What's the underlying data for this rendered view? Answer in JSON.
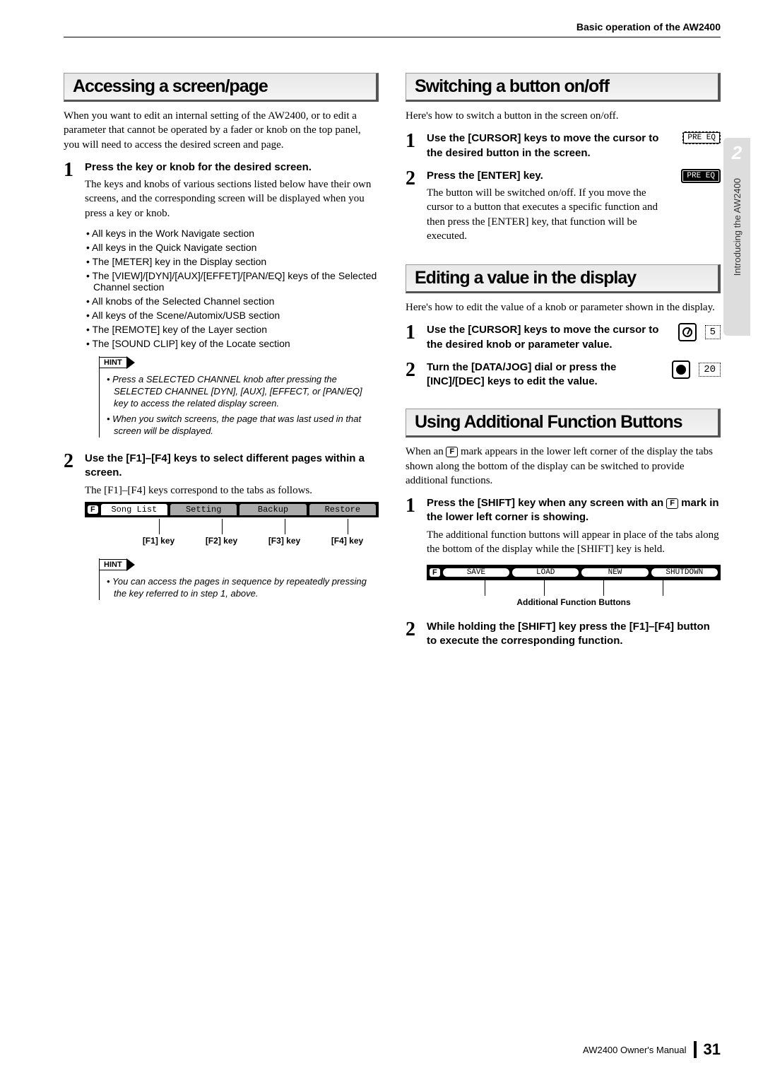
{
  "header": {
    "title": "Basic operation of the AW2400"
  },
  "sidetab": {
    "chapter": "2",
    "label": "Introducing the AW2400"
  },
  "left": {
    "h1": "Accessing a screen/page",
    "intro": "When you want to edit an internal setting of the AW2400, or to edit a parameter that cannot be operated by a fader or knob on the top panel, you will need to access the desired screen and page.",
    "s1": {
      "title": "Press the key or knob for the desired screen.",
      "para": "The keys and knobs of various sections listed below have their own screens, and the corresponding screen will be displayed when you press a key or knob.",
      "bullets": [
        "All keys in the Work Navigate section",
        "All keys in the Quick Navigate section",
        "The [METER] key in the Display section",
        "The [VIEW]/[DYN]/[AUX]/[EFFET]/[PAN/EQ] keys of the Selected Channel section",
        "All knobs of the Selected Channel section",
        "All keys of the Scene/Automix/USB section",
        "The [REMOTE] key of the Layer section",
        "The [SOUND CLIP] key of the Locate section"
      ],
      "hint_label": "HINT",
      "hints": [
        "Press a SELECTED CHANNEL knob after pressing the SELECTED CHANNEL [DYN], [AUX], [EFFECT, or [PAN/EQ] key to access the related display screen.",
        "When you switch screens, the page that was last used in that screen will be displayed."
      ]
    },
    "s2": {
      "title": "Use the [F1]–[F4] keys to select different pages within a screen.",
      "para": "The [F1]–[F4] keys correspond to the tabs as follows.",
      "tabs": {
        "fmark": "F",
        "t1": "Song List",
        "t2": "Setting",
        "t3": "Backup",
        "t4": "Restore"
      },
      "labels": {
        "l1": "[F1] key",
        "l2": "[F2] key",
        "l3": "[F3] key",
        "l4": "[F4] key"
      },
      "hint_label": "HINT",
      "hints": [
        "You can access the pages in sequence by repeatedly pressing the key referred to in step 1, above."
      ]
    }
  },
  "rA": {
    "h1": "Switching a button on/off",
    "intro": "Here's how to switch a button in the screen on/off.",
    "s1": {
      "title": "Use the [CURSOR] keys to move the cursor to the desired button in the screen.",
      "btn": "PRE EQ"
    },
    "s2": {
      "title": "Press the [ENTER] key.",
      "para": "The button will be switched on/off. If you move the cursor to a button that executes a specific function and then press the [ENTER] key, that function will be executed.",
      "btn": "PRE EQ"
    }
  },
  "rB": {
    "h1": "Editing a value in the display",
    "intro": "Here's how to edit the value of a knob or parameter shown in the display.",
    "s1": {
      "title": "Use the [CURSOR] keys to move the cursor to the desired knob or parameter value.",
      "val": "5"
    },
    "s2": {
      "title": "Turn the [DATA/JOG] dial or press the [INC]/[DEC] keys to edit the value.",
      "val": "20"
    }
  },
  "rC": {
    "h1": "Using Additional Function Buttons",
    "intro_a": "When an ",
    "intro_mark": "F",
    "intro_b": " mark appears in the lower left corner of the display the tabs shown along the bottom of the display can be switched to provide additional functions.",
    "s1": {
      "title_a": "Press the [SHIFT] key when any screen with an ",
      "title_mark": "F",
      "title_b": " mark in the lower left corner is showing.",
      "para": "The additional function buttons will appear in place of the tabs along the bottom of the display while the [SHIFT] key is held.",
      "fns": {
        "fmark": "F",
        "a": "SAVE",
        "b": "LOAD",
        "c": "NEW",
        "d": "SHUTDOWN"
      },
      "cap": "Additional Function Buttons"
    },
    "s2": {
      "title": "While holding the [SHIFT] key press the [F1]–[F4] button to execute the corresponding function."
    }
  },
  "footer": {
    "manual": "AW2400  Owner's Manual",
    "page": "31"
  }
}
